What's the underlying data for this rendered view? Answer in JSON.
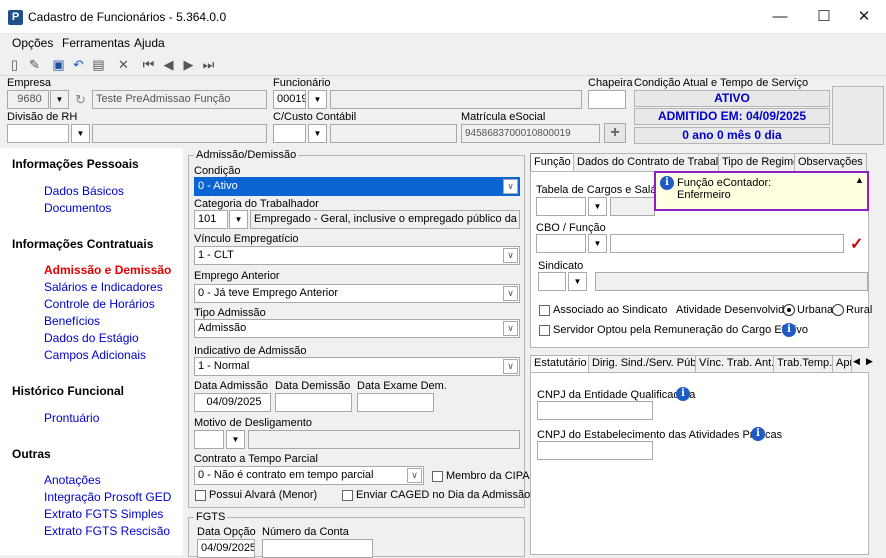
{
  "window": {
    "title": "Cadastro de Funcionários - 5.364.0.0",
    "minimize": "—",
    "maximize": "☐",
    "close": "✕"
  },
  "menu": [
    "Opções",
    "Ferramentas",
    "Ajuda"
  ],
  "header": {
    "empresa_label": "Empresa",
    "empresa_code": "9680",
    "empresa_name": "Teste PreAdmissao Função",
    "funcionario_label": "Funcionário",
    "funcionario_code": "00019",
    "chapeira_label": "Chapeira",
    "divisao_label": "Divisão de RH",
    "custo_label": "C/Custo Contábil",
    "matricula_label": "Matrícula eSocial",
    "matricula_value": "9458683700010800019",
    "condicao_label": "Condição Atual e Tempo de Serviço",
    "status": "ATIVO",
    "admitido": "ADMITIDO EM: 04/09/2025",
    "tempo": "0 ano 0 mês 0 dia"
  },
  "sidebar": {
    "sections": [
      {
        "title": "Informações Pessoais",
        "items": [
          "Dados Básicos",
          "Documentos"
        ]
      },
      {
        "title": "Informações Contratuais",
        "items": [
          "Admissão e Demissão",
          "Salários e Indicadores",
          "Controle de Horários",
          "Benefícios",
          "Dados do Estágio",
          "Campos Adicionais"
        ]
      },
      {
        "title": "Histórico Funcional",
        "items": [
          "Prontuário"
        ]
      },
      {
        "title": "Outras",
        "items": [
          "Anotações",
          "Integração Prosoft GED",
          "Extrato FGTS Simples",
          "Extrato FGTS Rescisão"
        ]
      }
    ]
  },
  "admissao": {
    "group_title": "Admissão/Demissão",
    "condicao_label": "Condição",
    "condicao_value": "0 - Ativo",
    "categoria_label": "Categoria do Trabalhador",
    "categoria_code": "101",
    "categoria_desc": "Empregado - Geral, inclusive o empregado público da administ",
    "vinculo_label": "Vínculo Empregatício",
    "vinculo_value": "1 - CLT",
    "emprego_label": "Emprego Anterior",
    "emprego_value": "0 - Já teve Emprego Anterior",
    "tipo_label": "Tipo Admissão",
    "tipo_value": "Admissão",
    "indicativo_label": "Indicativo de Admissão",
    "indicativo_value": "1 - Normal",
    "data_adm_label": "Data Admissão",
    "data_adm_value": "04/09/2025",
    "data_dem_label": "Data Demissão",
    "data_exame_label": "Data Exame Dem.",
    "motivo_label": "Motivo de Desligamento",
    "contrato_label": "Contrato a Tempo Parcial",
    "contrato_value": "0 - Não é contrato em tempo parcial",
    "cipa_label": "Membro da CIPA",
    "alvara_label": "Possui Alvará (Menor)",
    "caged_label": "Enviar CAGED no Dia da Admissão?"
  },
  "fgts": {
    "group_title": "FGTS",
    "data_opcao_label": "Data Opção",
    "data_opcao_value": "04/09/2025",
    "conta_label": "Número da Conta"
  },
  "right_tabs": [
    "Função",
    "Dados do Contrato de Trabalho",
    "Tipo de Regime",
    "Observações"
  ],
  "funcao": {
    "tabela_label": "Tabela de Cargos e Salários",
    "tooltip_line1": "Função eContador:",
    "tooltip_line2": "Enfermeiro",
    "cbo_label": "CBO / Função",
    "sindicato_label": "Sindicato",
    "associado_label": "Associado ao Sindicato",
    "atividade_label": "Atividade Desenvolvida:",
    "urbana_label": "Urbana",
    "rural_label": "Rural",
    "servidor_label": "Servidor Optou pela Remuneração do Cargo Efetivo"
  },
  "bottom_tabs": [
    "Estatutário",
    "Dirig. Sind./Serv. Púb.",
    "Vínc. Trab. Ant.",
    "Trab.Temp.",
    "Apr"
  ],
  "estatutario": {
    "cnpj_qual_label": "CNPJ da Entidade Qualificadora",
    "cnpj_estab_label": "CNPJ do Estabelecimento das Atividades Práticas"
  },
  "colors": {
    "link": "#0000cc",
    "active_link": "#e00000",
    "status_text": "#0000cc",
    "selected_bg": "#0a64d2",
    "tooltip_border": "#8b1fc8"
  }
}
